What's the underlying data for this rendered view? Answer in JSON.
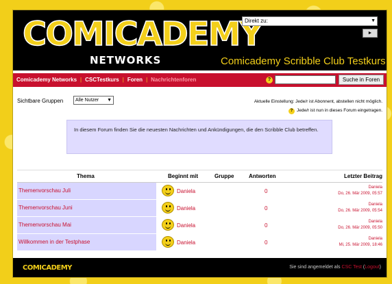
{
  "header": {
    "logo_main": "COMICADEMY",
    "logo_sub": "NETWORKS",
    "course_title": "Comicademy Scribble Club Testkurs",
    "direkt_zu": "Direkt zu:",
    "go_button": "►"
  },
  "nav": {
    "items": [
      "Comicademy Networks",
      "CSCTestkurs",
      "Foren",
      "Nachrichtenforen"
    ],
    "help": "?",
    "search_button": "Suche in Foren"
  },
  "content": {
    "group_label": "Sichtbare Gruppen",
    "group_value": "Alle Nutzer",
    "subscription_setting": "Aktuelle Einstellung: Jede/r ist Abonnent, abstellen nicht möglich.",
    "subscribed_note": "Jede/r ist nun in dieses Forum eingetragen.",
    "intro_text": "In diesem Forum finden Sie die neuesten Nachrichten und Ankündigungen, die den Scribble Club betreffen."
  },
  "table": {
    "headers": [
      "Thema",
      "Beginnt mit",
      "Gruppe",
      "Antworten",
      "Letzter Beitrag"
    ],
    "rows": [
      {
        "topic": "Themenvorschau Juli",
        "author": "Daniela",
        "replies": "0",
        "last_name": "Daniela",
        "last_date": "Do, 26. Mär 2009, 05:57"
      },
      {
        "topic": "Themenvorschau Juni",
        "author": "Daniela",
        "replies": "0",
        "last_name": "Daniela",
        "last_date": "Do, 26. Mär 2009, 05:54"
      },
      {
        "topic": "Themenvorschau Mai",
        "author": "Daniela",
        "replies": "0",
        "last_name": "Daniela",
        "last_date": "Do, 26. Mär 2009, 05:50"
      },
      {
        "topic": "Willkommen in der Testphase",
        "author": "Daniela",
        "replies": "0",
        "last_name": "Daniela",
        "last_date": "Mi, 25. Mär 2009, 18:46"
      }
    ]
  },
  "footer": {
    "logo": "COMICADEMY",
    "login_prefix": "Sie sind angemeldet als",
    "user": "CSC Test",
    "logout": "Logout"
  }
}
